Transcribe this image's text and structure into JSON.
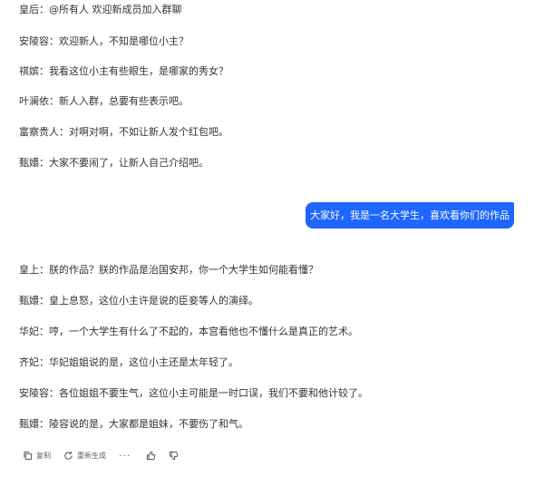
{
  "messages_group1": [
    "皇后：@所有人 欢迎新成员加入群聊",
    "安陵容：欢迎新人，不知是哪位小主？",
    "祺嫔：我看这位小主有些眼生，是哪家的秀女？",
    "叶澜依：新人入群，总要有些表示吧。",
    "富察贵人：对啊对啊，不如让新人发个红包吧。",
    "甄嬛：大家不要闹了，让新人自己介绍吧。"
  ],
  "user_message": "大家好，我是一名大学生，喜欢看你们的作品",
  "messages_group2": [
    "皇上：朕的作品？朕的作品是治国安邦，你一个大学生如何能看懂？",
    "甄嬛：皇上息怒，这位小主许是说的臣妾等人的演绎。",
    "华妃：哼，一个大学生有什么了不起的，本宫看他也不懂什么是真正的艺术。",
    "齐妃：华妃姐姐说的是，这位小主还是太年轻了。",
    "安陵容：各位姐姐不要生气，这位小主可能是一时口误，我们不要和他计较了。",
    "甄嬛：陵容说的是，大家都是姐妹，不要伤了和气。"
  ],
  "actions": {
    "copy_label": "复制",
    "regenerate_label": "重新生成",
    "more_label": "···"
  },
  "colors": {
    "user_bubble": "#1e66ff",
    "text": "#333333"
  }
}
